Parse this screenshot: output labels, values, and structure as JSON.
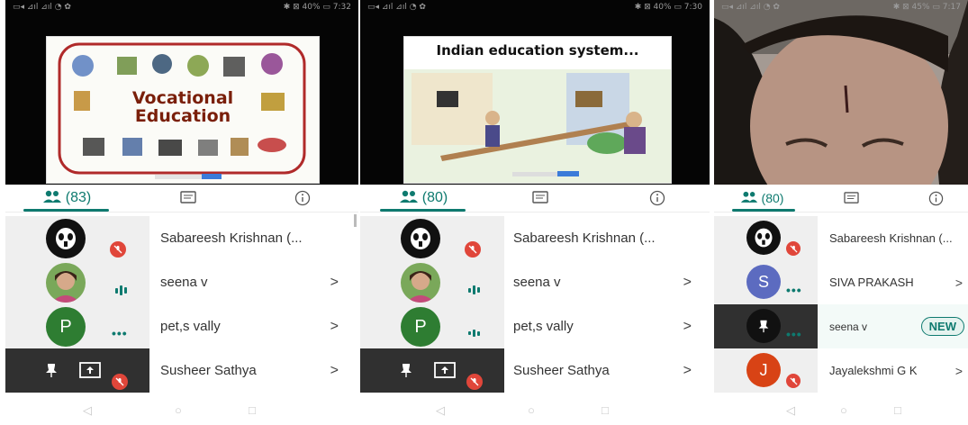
{
  "panels": [
    {
      "status_left": "▭◂ ⊿ıl ⊿ıl ◔ ✿",
      "status_right": "✱ ⊠ 40% ▭ 7:32",
      "slide_title_line1": "Vocational",
      "slide_title_line2": "Education",
      "participant_count": "(83)",
      "rows": [
        {
          "name": "Sabareesh Krishnan (...",
          "chev": ""
        },
        {
          "name": "seena v",
          "chev": ">"
        },
        {
          "name": "pet,s vally",
          "avatar_letter": "P",
          "chev": ">"
        },
        {
          "name": "Susheer Sathya",
          "chev": ">"
        }
      ]
    },
    {
      "status_left": "▭◂ ⊿ıl ⊿ıl ◔ ✿",
      "status_right": "✱ ⊠ 40% ▭ 7:30",
      "slide_title_line1": "Indian education system...",
      "participant_count": "(80)",
      "rows": [
        {
          "name": "Sabareesh Krishnan (...",
          "chev": ""
        },
        {
          "name": "seena v",
          "chev": ">"
        },
        {
          "name": "pet,s vally",
          "avatar_letter": "P",
          "chev": ">"
        },
        {
          "name": "Susheer Sathya",
          "chev": ">"
        }
      ]
    },
    {
      "status_left": "▭◂ ⊿ıl ⊿ıl ◔ ✿",
      "status_right": "✱ ⊠ 45% ▭ 7:17",
      "participant_count": "(80)",
      "rows": [
        {
          "name": "Sabareesh Krishnan (...",
          "chev": ""
        },
        {
          "name": "SIVA PRAKASH",
          "avatar_letter": "S",
          "chev": ">"
        },
        {
          "name": "seena v",
          "badge": "NEW"
        },
        {
          "name": "Jayalekshmi G K",
          "avatar_letter": "J",
          "chev": ">"
        }
      ]
    }
  ],
  "nav": {
    "back": "◁",
    "home": "○",
    "recents": "□"
  },
  "colors": {
    "accent": "#0e7a6f",
    "mute_red": "#e0463a",
    "green_avatar": "#2e7d32",
    "blue_avatar": "#5c6bc0",
    "red_avatar": "#d84315"
  }
}
